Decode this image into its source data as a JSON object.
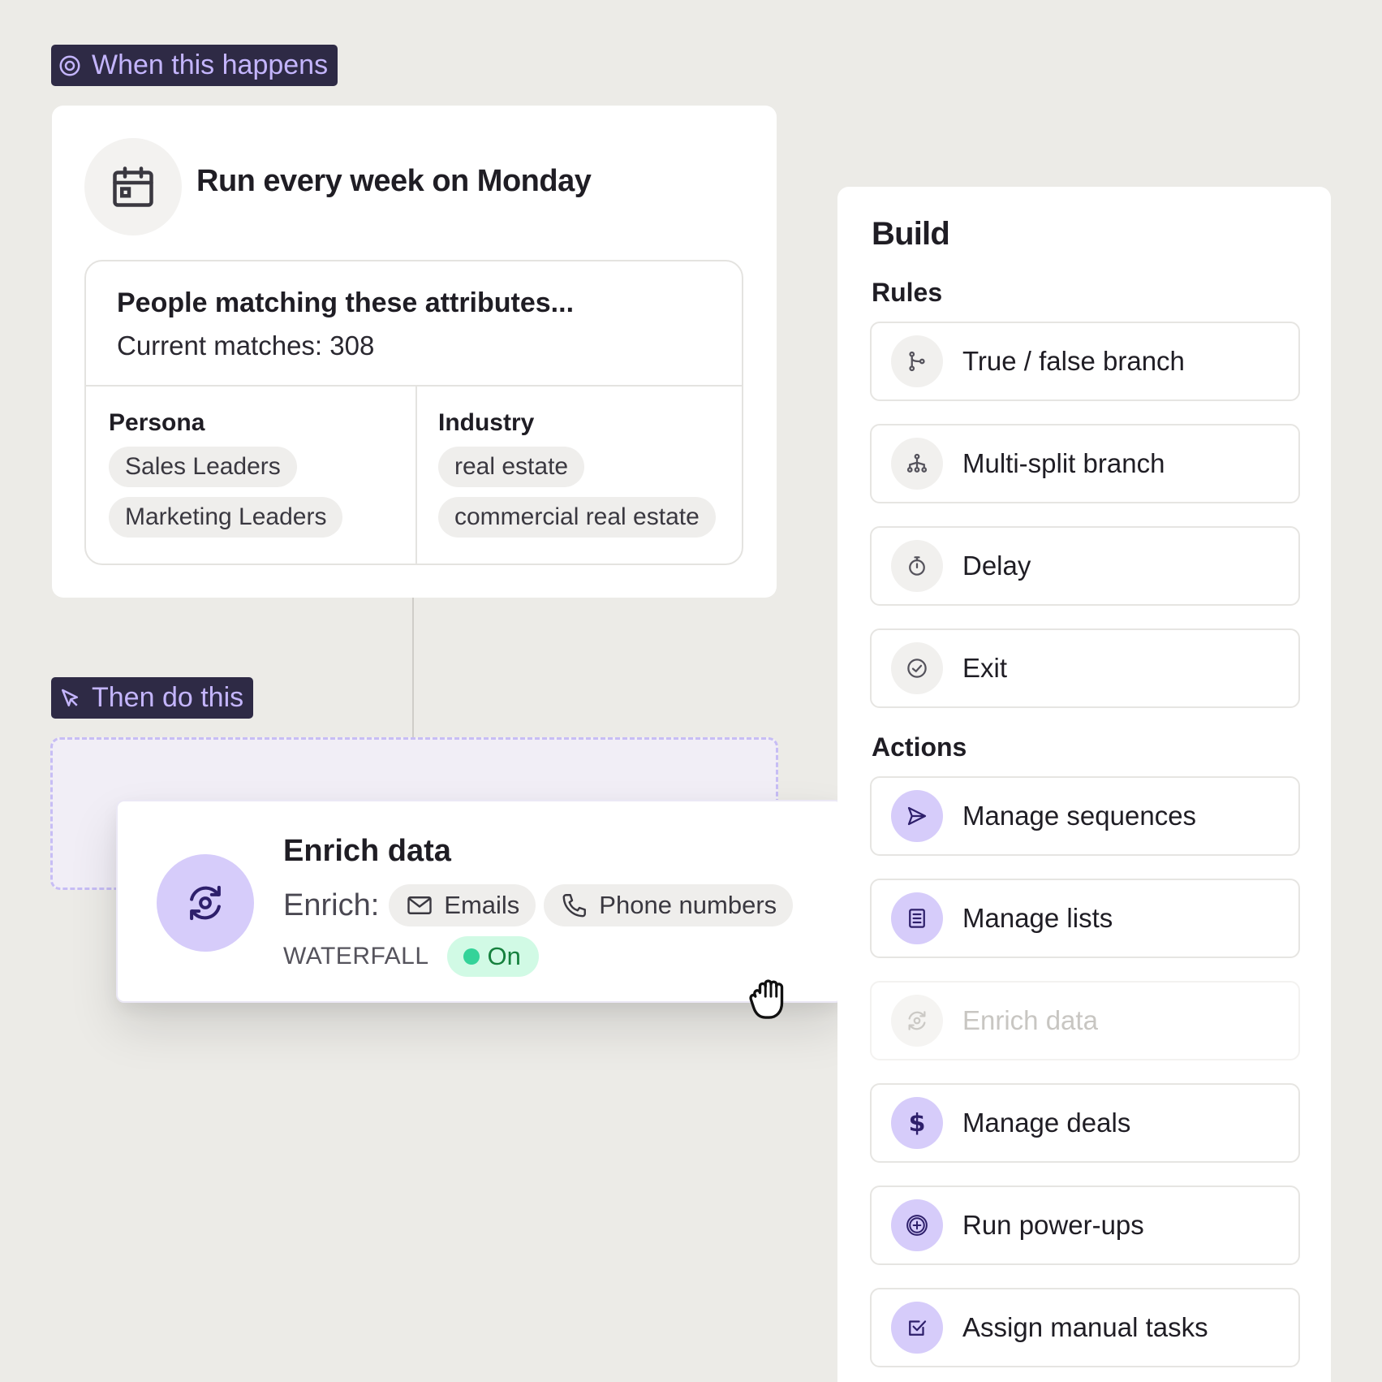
{
  "trigger": {
    "tag_label": "When this happens",
    "title": "Run every week on Monday",
    "match_title": "People matching these attributes...",
    "match_count": "Current matches: 308",
    "persona": {
      "label": "Persona",
      "chips": [
        "Sales Leaders",
        "Marketing Leaders"
      ]
    },
    "industry": {
      "label": "Industry",
      "chips": [
        "real estate",
        "commercial real estate"
      ]
    }
  },
  "action": {
    "tag_label": "Then do this",
    "card": {
      "title": "Enrich data",
      "enrich_label": "Enrich:",
      "targets": [
        "Emails",
        "Phone numbers"
      ],
      "waterfall_label": "WATERFALL",
      "status": "On"
    }
  },
  "build": {
    "title": "Build",
    "rules_label": "Rules",
    "rules": [
      {
        "label": "True / false branch",
        "icon": "branch-icon"
      },
      {
        "label": "Multi-split branch",
        "icon": "multi-split-icon"
      },
      {
        "label": "Delay",
        "icon": "stopwatch-icon"
      },
      {
        "label": "Exit",
        "icon": "check-circle-icon"
      }
    ],
    "actions_label": "Actions",
    "actions": [
      {
        "label": "Manage sequences",
        "icon": "send-icon"
      },
      {
        "label": "Manage lists",
        "icon": "list-icon"
      },
      {
        "label": "Enrich data",
        "icon": "refresh-target-icon"
      },
      {
        "label": "Manage deals",
        "icon": "dollar-icon"
      },
      {
        "label": "Run power-ups",
        "icon": "plus-badge-icon"
      },
      {
        "label": "Assign manual tasks",
        "icon": "checkbox-icon"
      }
    ]
  },
  "colors": {
    "background": "#ecebe7",
    "tag_bg": "#2e2a45",
    "tag_text": "#c4b5fd",
    "accent_purple": "#d6ccfa",
    "status_green": "#34d399"
  }
}
